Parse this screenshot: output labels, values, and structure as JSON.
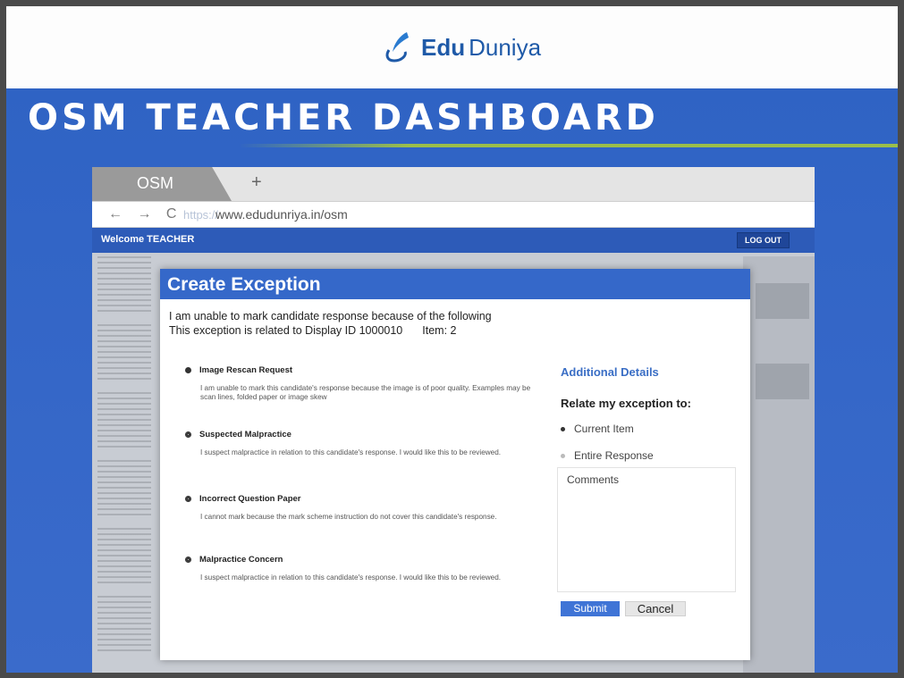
{
  "logo": {
    "part1": "Edu",
    "part2": "Duniya"
  },
  "slide": {
    "title": "OSM TEACHER DASHBOARD"
  },
  "browser": {
    "tab_label": "OSM",
    "tab_add": "+",
    "nav_icons": "← → C",
    "url_protocol": "https://",
    "url": "www.edudunriya.in/osm"
  },
  "app": {
    "welcome": "Welcome TEACHER",
    "logout_label": "LOG OUT"
  },
  "modal": {
    "title": "Create Exception",
    "intro_line1": "I am unable to mark candidate response because of the following",
    "intro_line2": "This exception is related to Display ID 1000010",
    "intro_item": "Item: 2",
    "options": [
      {
        "title": "Image Rescan Request",
        "desc": "I am unable to mark this candidate's response because the image is of poor quality. Examples may be scan lines, folded paper or image skew",
        "selected": true
      },
      {
        "title": "Suspected Malpractice",
        "desc": "I suspect malpractice in relation to this candidate's response. I would like this to be reviewed.",
        "selected": false
      },
      {
        "title": "Incorrect Question Paper",
        "desc": "I cannot mark because the mark scheme instruction do not cover this candidate's response.",
        "selected": false
      },
      {
        "title": "Malpractice Concern",
        "desc": "I suspect malpractice in relation to this candidate's response. I would like this to be reviewed.",
        "selected": false
      }
    ],
    "side": {
      "title": "Additional Details",
      "relate_label": "Relate my exception to:",
      "option_current": "Current Item",
      "option_entire": "Entire Response",
      "comments_placeholder": "Comments"
    },
    "submit_label": "Submit",
    "cancel_label": "Cancel"
  },
  "colors": {
    "slide_blue": "#3266c6",
    "modal_header_blue": "#3568c9",
    "accent_green": "#9bbf4a",
    "link_blue": "#3a6ec5"
  }
}
